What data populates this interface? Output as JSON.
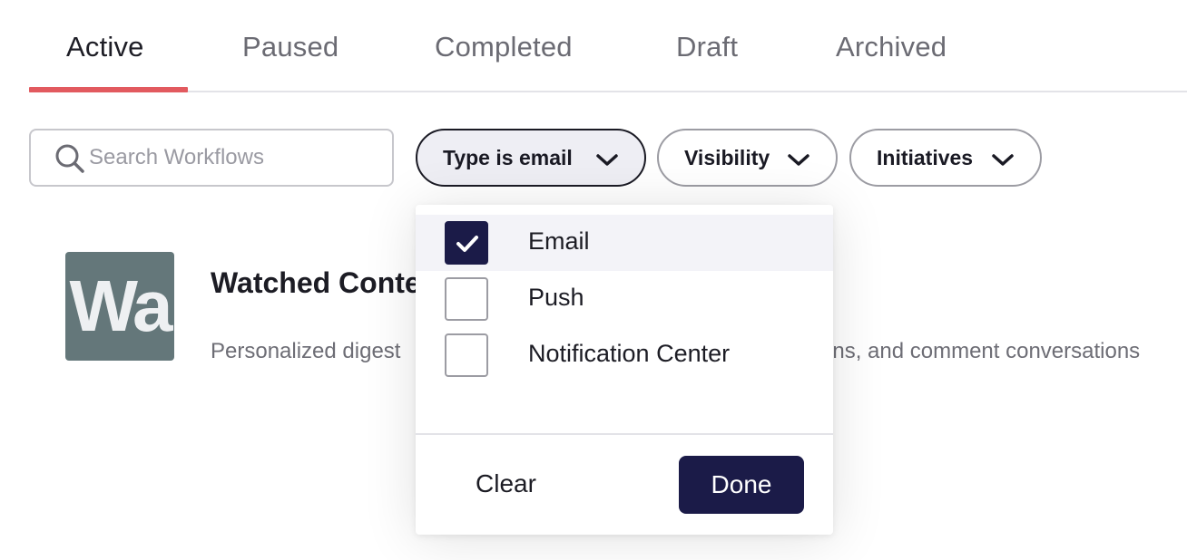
{
  "tabs": [
    {
      "label": "Active",
      "active": true
    },
    {
      "label": "Paused",
      "active": false
    },
    {
      "label": "Completed",
      "active": false
    },
    {
      "label": "Draft",
      "active": false
    },
    {
      "label": "Archived",
      "active": false
    }
  ],
  "search": {
    "placeholder": "Search Workflows",
    "value": "",
    "icon": "search-icon"
  },
  "filters": {
    "type": {
      "prefix": "Type",
      "value": "is email",
      "icon": "chevron-down-icon"
    },
    "visibility": {
      "label": "Visibility",
      "icon": "chevron-down-icon"
    },
    "initiatives": {
      "label": "Initiatives",
      "icon": "chevron-down-icon"
    }
  },
  "workflow": {
    "avatar_text": "Wa",
    "title": "Watched Conte",
    "description_left": "Personalized digest",
    "description_right": "ons, and comment conversations"
  },
  "type_dropdown": {
    "options": [
      {
        "label": "Email",
        "checked": true
      },
      {
        "label": "Push",
        "checked": false
      },
      {
        "label": "Notification Center",
        "checked": false
      }
    ],
    "clear_label": "Clear",
    "done_label": "Done"
  },
  "colors": {
    "accent_underline": "#e25a5f",
    "primary_button": "#1b1b48",
    "avatar_bg": "#64777a"
  }
}
